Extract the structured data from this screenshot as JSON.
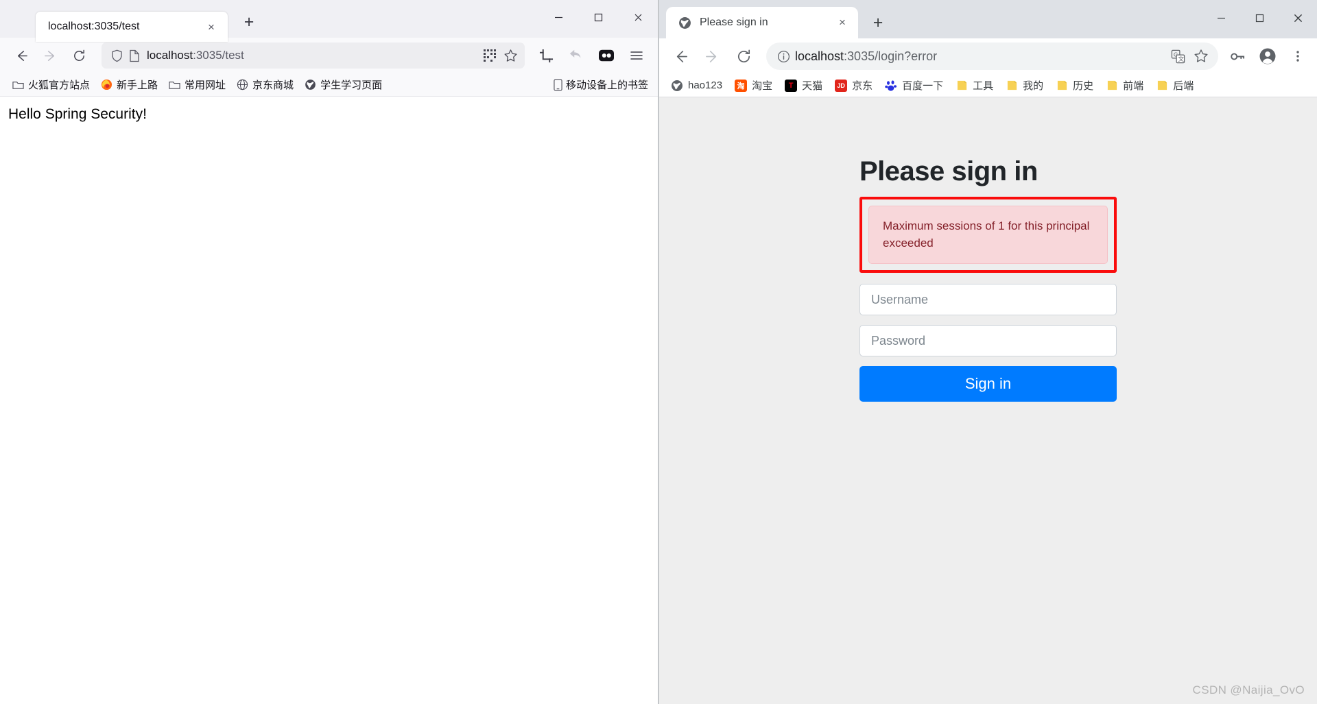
{
  "firefox": {
    "tab": {
      "title": "localhost:3035/test",
      "close_label": "×"
    },
    "new_tab_label": "+",
    "window_controls": {
      "minimize": "minimize-icon",
      "maximize": "maximize-icon",
      "close": "close-icon"
    },
    "nav": {
      "back": "back-arrow-icon",
      "forward": "forward-arrow-icon",
      "reload": "reload-icon"
    },
    "url": {
      "prefix": "localhost",
      "suffix": ":3035/test",
      "shield_icon": "shield-icon",
      "page_icon": "page-icon"
    },
    "url_actions": {
      "qr": "qr-code-icon",
      "bookmark": "star-icon"
    },
    "toolbar_icons": [
      "crop-icon",
      "undo-icon",
      "firefox-view-icon",
      "hamburger-menu-icon"
    ],
    "bookmarks": [
      {
        "label": "火狐官方站点",
        "icon": "folder-outline-icon"
      },
      {
        "label": "新手上路",
        "icon": "firefox-logo-icon"
      },
      {
        "label": "常用网址",
        "icon": "folder-outline-icon"
      },
      {
        "label": "京东商城",
        "icon": "globe-icon"
      },
      {
        "label": "学生学习页面",
        "icon": "globe-dark-icon"
      }
    ],
    "bookmarks_right": {
      "label": "移动设备上的书签",
      "icon": "mobile-icon"
    },
    "page": {
      "heading": "Hello Spring Security!"
    }
  },
  "chrome": {
    "tab": {
      "title": "Please sign in",
      "favicon": "globe-icon",
      "close_label": "×"
    },
    "new_tab_label": "+",
    "window_controls": {
      "minimize": "minimize-icon",
      "maximize": "maximize-icon",
      "close": "close-icon"
    },
    "nav": {
      "back": "back-arrow-icon",
      "forward": "forward-arrow-icon",
      "reload": "reload-icon"
    },
    "url": {
      "prefix": "localhost",
      "suffix": ":3035/login?error",
      "info_icon": "info-circle-icon"
    },
    "url_actions": {
      "translate": "translate-icon",
      "bookmark": "star-icon"
    },
    "toolbar_icons": [
      "key-icon",
      "profile-avatar-icon",
      "three-dot-menu-icon"
    ],
    "bookmarks": [
      {
        "label": "hao123",
        "icon": "globe-icon",
        "color": "#5f6368",
        "text": ""
      },
      {
        "label": "淘宝",
        "icon": "taobao-icon",
        "color": "#ff5000",
        "text": "淘"
      },
      {
        "label": "天猫",
        "icon": "tmall-icon",
        "color": "#000000",
        "text": "T"
      },
      {
        "label": "京东",
        "icon": "jd-icon",
        "color": "#e1251b",
        "text": "JD"
      },
      {
        "label": "百度一下",
        "icon": "baidu-icon",
        "color": "#2932e1",
        "text": "百"
      },
      {
        "label": "工具",
        "icon": "folder-icon",
        "color": "#f7d154",
        "text": ""
      },
      {
        "label": "我的",
        "icon": "folder-icon",
        "color": "#f7d154",
        "text": ""
      },
      {
        "label": "历史",
        "icon": "folder-icon",
        "color": "#f7d154",
        "text": ""
      },
      {
        "label": "前端",
        "icon": "folder-icon",
        "color": "#f7d154",
        "text": ""
      },
      {
        "label": "后端",
        "icon": "folder-icon",
        "color": "#f7d154",
        "text": ""
      }
    ],
    "login": {
      "title": "Please sign in",
      "alert_message": "Maximum sessions of 1 for this principal exceeded",
      "alert_border_color": "#fa0c0c",
      "alert_bg_color": "#f8d7da",
      "alert_text_color": "#842029",
      "username_placeholder": "Username",
      "username_value": "",
      "password_placeholder": "Password",
      "password_value": "",
      "submit_label": "Sign in",
      "submit_color": "#007bff"
    }
  },
  "watermark": {
    "text": "CSDN @Naijia_OvO"
  }
}
